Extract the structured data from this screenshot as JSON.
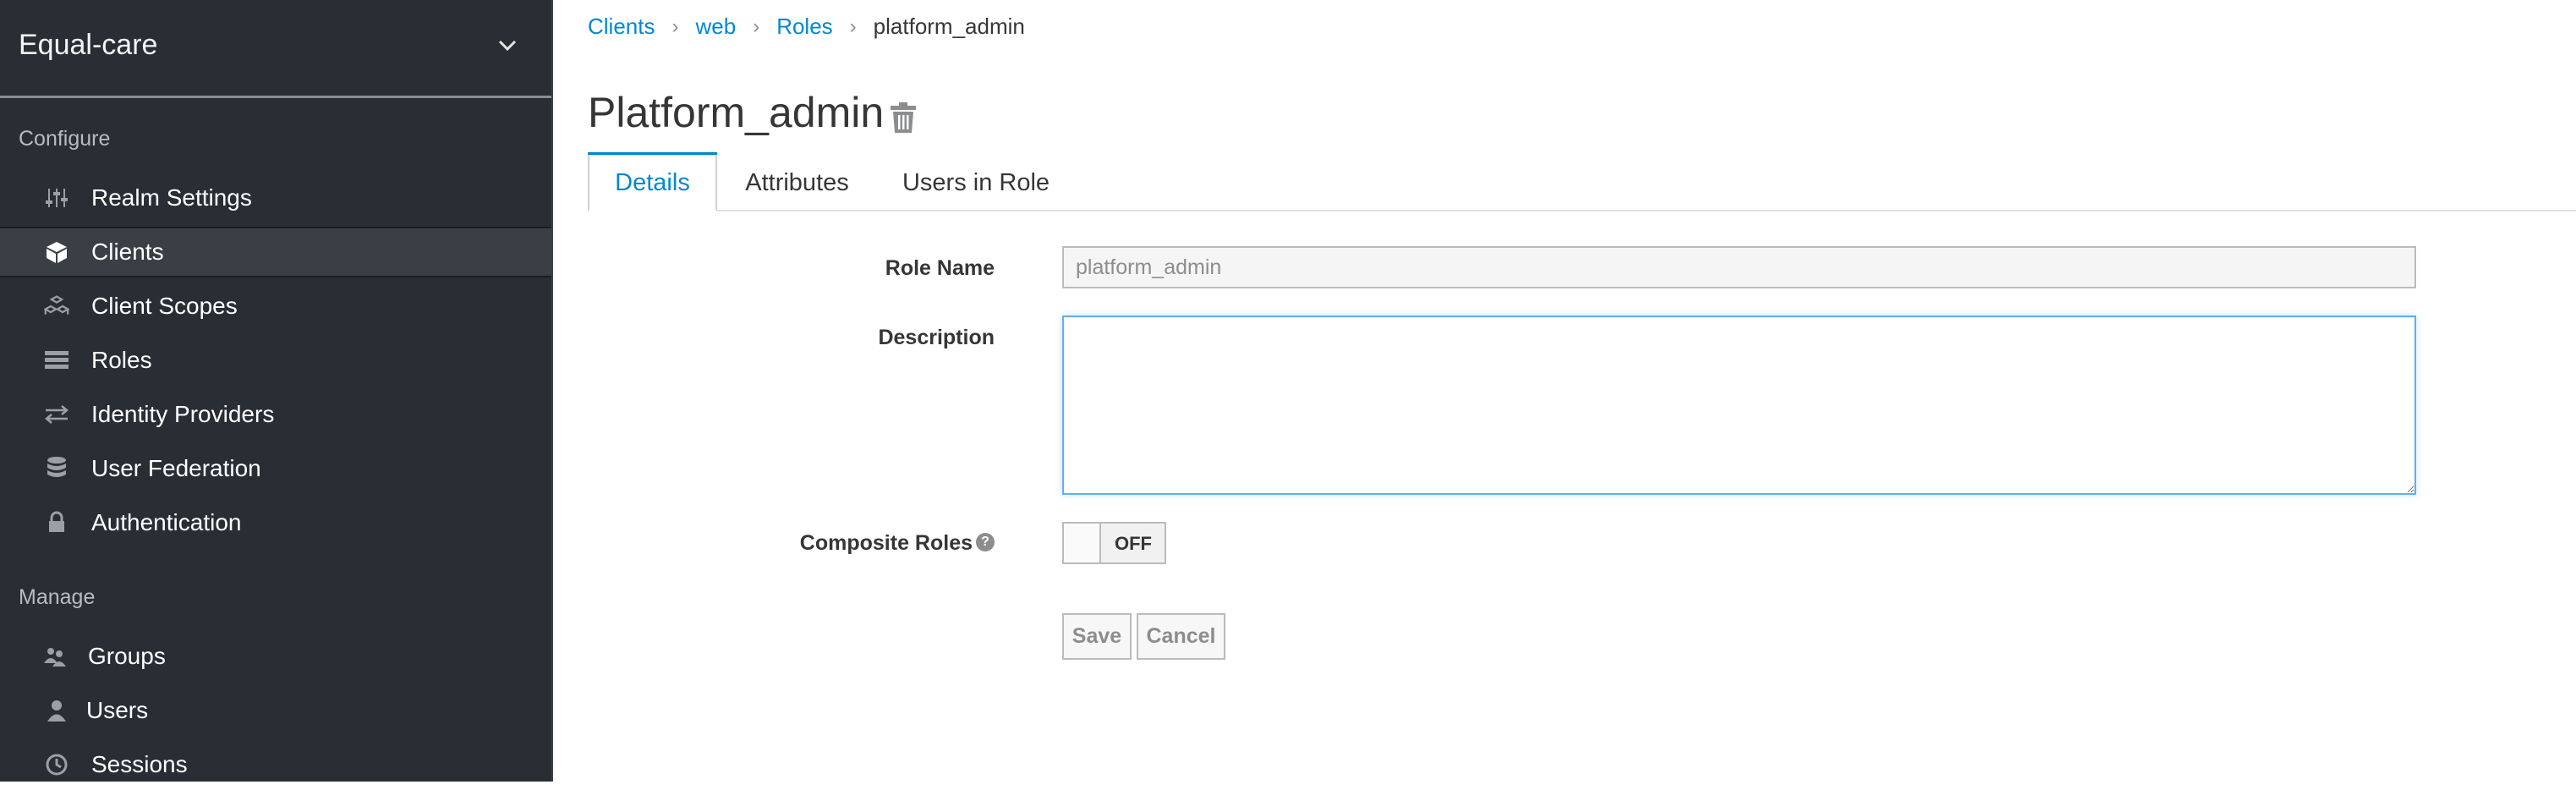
{
  "sidebar": {
    "realm_name": "Equal-care",
    "sections": {
      "configure": "Configure",
      "manage": "Manage"
    },
    "configure_items": [
      {
        "label": "Realm Settings",
        "icon": "sliders-icon"
      },
      {
        "label": "Clients",
        "icon": "cube-icon",
        "active": true
      },
      {
        "label": "Client Scopes",
        "icon": "cubes-icon"
      },
      {
        "label": "Roles",
        "icon": "list-icon"
      },
      {
        "label": "Identity Providers",
        "icon": "exchange-icon"
      },
      {
        "label": "User Federation",
        "icon": "database-icon"
      },
      {
        "label": "Authentication",
        "icon": "lock-icon"
      }
    ],
    "manage_items": [
      {
        "label": "Groups",
        "icon": "users-icon"
      },
      {
        "label": "Users",
        "icon": "user-icon"
      },
      {
        "label": "Sessions",
        "icon": "clock-icon"
      }
    ]
  },
  "breadcrumb": [
    "Clients",
    "web",
    "Roles",
    "platform_admin"
  ],
  "page_title": "Platform_admin",
  "tabs": [
    {
      "label": "Details",
      "active": true
    },
    {
      "label": "Attributes"
    },
    {
      "label": "Users in Role"
    }
  ],
  "form": {
    "role_name_label": "Role Name",
    "role_name_value": "platform_admin",
    "description_label": "Description",
    "description_value": "",
    "composite_label": "Composite Roles",
    "composite_state": "OFF",
    "help_glyph": "?",
    "save_label": "Save",
    "cancel_label": "Cancel"
  },
  "colors": {
    "sidebar_bg": "#292e34",
    "accent": "#0088ce",
    "active_item_bg": "#393f44"
  }
}
